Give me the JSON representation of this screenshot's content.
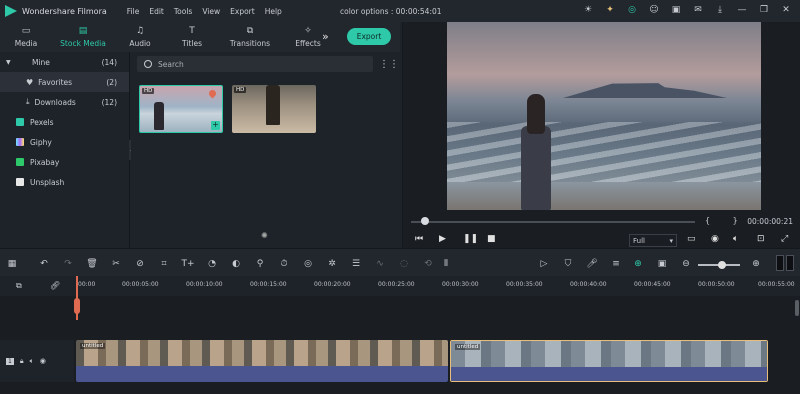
{
  "window": {
    "app_name": "Wondershare Filmora",
    "menus": [
      "File",
      "Edit",
      "Tools",
      "View",
      "Export",
      "Help"
    ],
    "title": "color options : 00:00:54:01",
    "title_icons": [
      "sun-icon",
      "bulb-icon",
      "headset-icon",
      "user-icon",
      "save-icon",
      "mail-icon",
      "download-icon",
      "minimize-icon",
      "restore-icon",
      "close-icon"
    ]
  },
  "media_tabs": [
    {
      "label": "Media",
      "icon": "folder-icon",
      "active": false
    },
    {
      "label": "Stock Media",
      "icon": "stock-media-icon",
      "active": true
    },
    {
      "label": "Audio",
      "icon": "music-note-icon",
      "active": false
    },
    {
      "label": "Titles",
      "icon": "text-icon",
      "active": false
    },
    {
      "label": "Transitions",
      "icon": "transitions-icon",
      "active": false
    },
    {
      "label": "Effects",
      "icon": "effects-icon",
      "active": false
    }
  ],
  "export_label": "Export",
  "sidebar": {
    "items": [
      {
        "label": "Mine",
        "count": "(14)"
      },
      {
        "label": "Favorites",
        "count": "(2)"
      },
      {
        "label": "Downloads",
        "count": "(12)"
      },
      {
        "label": "Pexels",
        "count": ""
      },
      {
        "label": "Giphy",
        "count": ""
      },
      {
        "label": "Pixabay",
        "count": ""
      },
      {
        "label": "Unsplash",
        "count": ""
      }
    ]
  },
  "library": {
    "search_placeholder": "Search",
    "thumbs": [
      {
        "badge": "HD",
        "selected": true,
        "favorite": true
      },
      {
        "badge": "HD",
        "selected": false,
        "favorite": false
      }
    ]
  },
  "preview": {
    "timecode": "00:00:00:21",
    "brackets": "{ }",
    "quality": "Full",
    "progress_fraction": 0.03
  },
  "ruler": {
    "labels": [
      "00:00",
      "00:00:05:00",
      "00:00:10:00",
      "00:00:15:00",
      "00:00:20:00",
      "00:00:25:00",
      "00:00:30:00",
      "00:00:35:00",
      "00:00:40:00",
      "00:00:45:00",
      "00:00:50:00",
      "00:00:55:00"
    ]
  },
  "timeline": {
    "track_number": "1",
    "clips": [
      {
        "label": "untitled"
      },
      {
        "label": "untitled"
      }
    ]
  },
  "colors": {
    "accent": "#2ec9a8",
    "playhead": "#e06b50",
    "selected_clip_border": "#e6c07a"
  }
}
